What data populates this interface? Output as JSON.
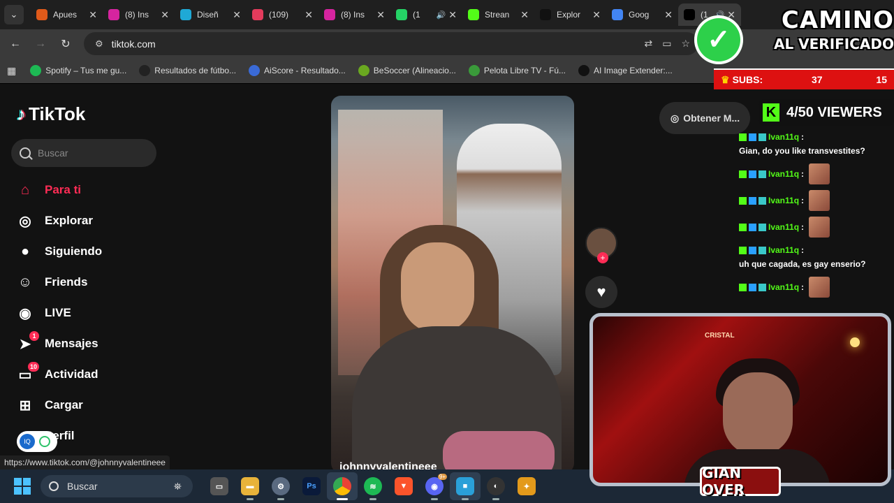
{
  "browser": {
    "tabs": [
      {
        "title": "Apues",
        "fav_color": "#e05a1a"
      },
      {
        "title": "(8) Ins",
        "fav_color": "#d6249f"
      },
      {
        "title": "Diseñ",
        "fav_color": "#1fa9d6"
      },
      {
        "title": "(109)",
        "fav_color": "#e33b5c"
      },
      {
        "title": "(8) Ins",
        "fav_color": "#d6249f"
      },
      {
        "title": "(1",
        "fav_color": "#25d366",
        "badge": "99+"
      },
      {
        "title": "Strean",
        "fav_color": "#53fc18"
      },
      {
        "title": "Explor",
        "fav_color": "#111111"
      },
      {
        "title": "Goog",
        "fav_color": "#4285f4"
      },
      {
        "title": "(1",
        "fav_color": "#000000",
        "active": true
      }
    ],
    "address": "tiktok.com",
    "bookmarks": [
      {
        "label": "Spotify – Tus me gu...",
        "color": "#1db954"
      },
      {
        "label": "Resultados de fútbo...",
        "color": "#222222"
      },
      {
        "label": "AiScore - Resultado...",
        "color": "#3a6ad6"
      },
      {
        "label": "BeSoccer (Alineacio...",
        "color": "#6aa820"
      },
      {
        "label": "Pelota Libre TV - Fú...",
        "color": "#3a9a3a"
      },
      {
        "label": "AI Image Extender:...",
        "color": "#111111"
      }
    ]
  },
  "tiktok": {
    "logo": "TikTok",
    "search_placeholder": "Buscar",
    "menu": [
      {
        "label": "Para ti",
        "icon": "home-icon"
      },
      {
        "label": "Explorar",
        "icon": "compass-icon"
      },
      {
        "label": "Siguiendo",
        "icon": "following-avatar-icon"
      },
      {
        "label": "Friends",
        "icon": "friends-icon"
      },
      {
        "label": "LIVE",
        "icon": "live-icon"
      },
      {
        "label": "Mensajes",
        "icon": "messages-icon",
        "badge": "1"
      },
      {
        "label": "Actividad",
        "icon": "activity-icon",
        "badge": "10"
      },
      {
        "label": "Cargar",
        "icon": "upload-icon"
      },
      {
        "label": "Perfil",
        "icon": "profile-icon"
      }
    ],
    "get_app": "Obtener M...",
    "video_user": "johnnyvalentineee",
    "status_url": "https://www.tiktok.com/@johnnyvalentineee"
  },
  "overlay": {
    "title_line1": "CAMINO",
    "title_line2": "AL VERIFICADO",
    "subs_label": "SUBS:",
    "subs_current": "37",
    "subs_goal": "15",
    "viewers": "4/50 VIEWERS",
    "chat": [
      {
        "user": "Ivan11q",
        "text": "Gian, do you like transvestites?"
      },
      {
        "user": "Ivan11q",
        "text": "",
        "emote": true
      },
      {
        "user": "Ivan11q",
        "text": "",
        "emote": true
      },
      {
        "user": "Ivan11q",
        "text": "",
        "emote": true
      },
      {
        "user": "Ivan11q",
        "text": "uh que cagada, es gay enserio?"
      },
      {
        "user": "Ivan11q",
        "text": "",
        "emote": true
      }
    ],
    "streamer_name": "GIAN OVER"
  },
  "taskbar": {
    "search": "Buscar"
  }
}
